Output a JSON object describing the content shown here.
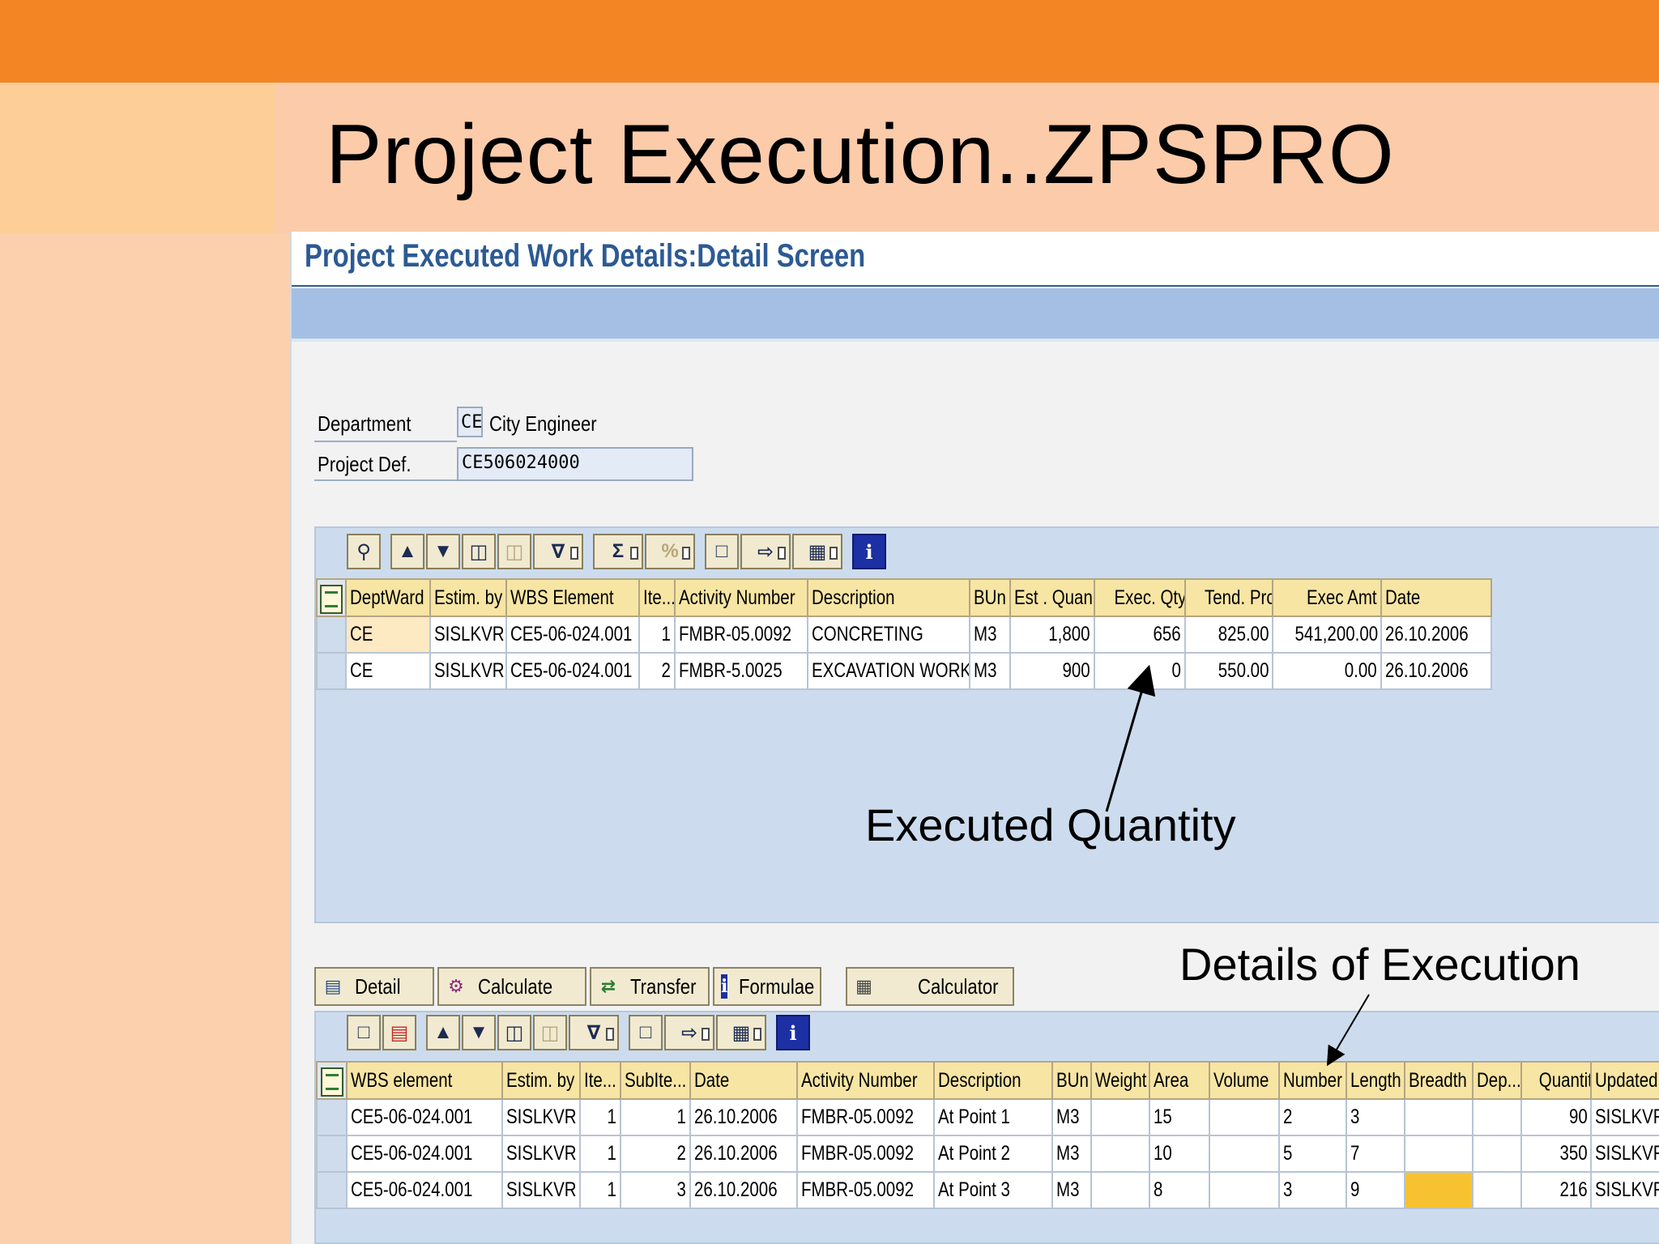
{
  "slide": {
    "title": "Project Execution..ZPSPRO"
  },
  "screen": {
    "title": "Project Executed Work Details:Detail Screen"
  },
  "header_fields": {
    "department_label": "Department",
    "department_code": "CE",
    "department_name": "City Engineer",
    "project_def_label": "Project Def.",
    "project_def_value": "CE506024000"
  },
  "upper_toolbar": {
    "icons": [
      "details-icon",
      "print-icon",
      "filter-sort-icon",
      "find-icon",
      "find-next-icon",
      "filter-icon",
      "sum-icon",
      "subtotal-icon",
      "print-preview-icon",
      "export-icon",
      "layout-icon",
      "info-icon"
    ]
  },
  "upper_table": {
    "columns": [
      "DeptWard",
      "Estim. by",
      "WBS Element",
      "Ite...",
      "Activity Number",
      "Description",
      "BUn",
      "Est . Quan",
      "Exec. Qty",
      "Tend. Prc",
      "Exec Amt",
      "Date"
    ],
    "rows": [
      [
        "CE",
        "SISLKVR",
        "CE5-06-024.001",
        "1",
        "FMBR-05.0092",
        "CONCRETING",
        "M3",
        "1,800",
        "656",
        "825.00",
        "541,200.00",
        "26.10.2006"
      ],
      [
        "CE",
        "SISLKVR",
        "CE5-06-024.001",
        "2",
        "FMBR-5.0025",
        "EXCAVATION WORK",
        "M3",
        "900",
        "0",
        "550.00",
        "0.00",
        "26.10.2006"
      ]
    ]
  },
  "annotations": {
    "executed_quantity": "Executed Quantity",
    "details_of_execution": "Details of Execution"
  },
  "action_buttons": {
    "detail": "Detail",
    "calculate": "Calculate",
    "transfer": "Transfer",
    "formulae": "Formulae",
    "calculator": "Calculator"
  },
  "lower_table": {
    "columns": [
      "WBS element",
      "Estim. by",
      "Ite...",
      "SubIte...",
      "Date",
      "Activity Number",
      "Description",
      "BUn",
      "Weight",
      "Area",
      "Volume",
      "Number",
      "Length",
      "Breadth",
      "Dep...",
      "Quantity",
      "Updated ..."
    ],
    "rows": [
      [
        "CE5-06-024.001",
        "SISLKVR",
        "1",
        "1",
        "26.10.2006",
        "FMBR-05.0092",
        "At Point 1",
        "M3",
        "",
        "15",
        "",
        "2",
        "3",
        "",
        "",
        "90",
        "SISLKVR"
      ],
      [
        "CE5-06-024.001",
        "SISLKVR",
        "1",
        "2",
        "26.10.2006",
        "FMBR-05.0092",
        "At Point 2",
        "M3",
        "",
        "10",
        "",
        "5",
        "7",
        "",
        "",
        "350",
        "SISLKVR"
      ],
      [
        "CE5-06-024.001",
        "SISLKVR",
        "1",
        "3",
        "26.10.2006",
        "FMBR-05.0092",
        "At Point 3",
        "M3",
        "",
        "8",
        "",
        "3",
        "9",
        "",
        "",
        "216",
        "SISLKVR"
      ]
    ]
  },
  "colors": {
    "top_bar": "#f48524",
    "slide_background": "#fcd0ac",
    "sap_title": "#2c5a93",
    "app_toolbar": "#a4bfe3",
    "header_cell": "#f7e5a4",
    "highlight_cell": "#f7c231"
  }
}
